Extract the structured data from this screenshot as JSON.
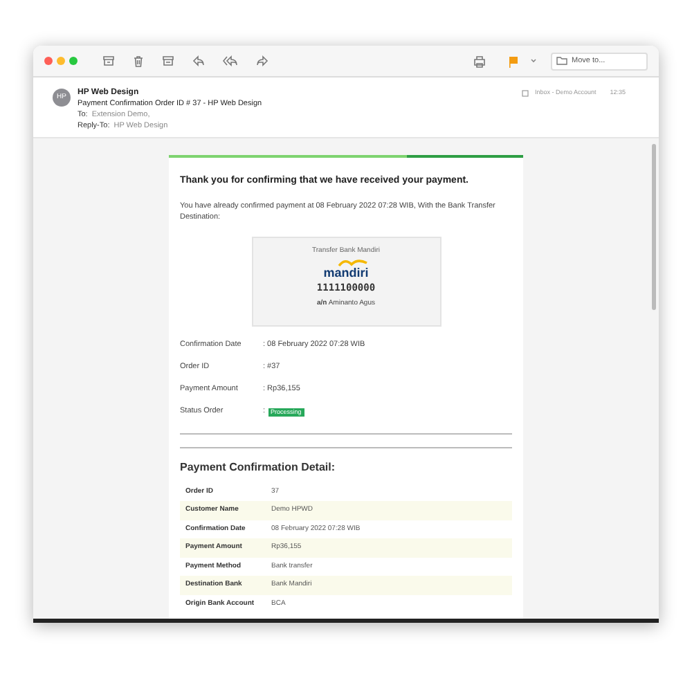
{
  "toolbar": {
    "move_to": "Move to..."
  },
  "header": {
    "avatar": "HP",
    "sender": "HP Web Design",
    "subject": "Payment Confirmation Order ID # 37 - HP Web Design",
    "to_label": "To:",
    "to": "Extension Demo,",
    "reply_label": "Reply-To:",
    "reply_to": "HP Web Design",
    "mailbox": "Inbox - Demo Account",
    "time": "12:35"
  },
  "email": {
    "heading": "Thank you for confirming that we have received your payment.",
    "intro": "You have already confirmed payment at 08 February 2022 07:28 WIB, With the Bank Transfer Destination:",
    "bank": {
      "title": "Transfer Bank Mandiri",
      "logo": "mandiri",
      "account": "1111100000",
      "holder": "**a/n** Aminanto Agus"
    },
    "summary": [
      {
        "label": "Confirmation Date",
        "value": ": 08 February 2022 07:28 WIB",
        "kind": "text"
      },
      {
        "label": "Order ID",
        "value": ": #37",
        "kind": "text"
      },
      {
        "label": "Payment Amount",
        "value": ": Rp36,155",
        "kind": "text"
      },
      {
        "label": "Status Order",
        "value": "Processing",
        "kind": "badge",
        "prefix": ":"
      }
    ],
    "detail_title": "Payment Confirmation Detail:",
    "detail_rows": [
      {
        "label": "Order ID",
        "value": "37"
      },
      {
        "label": "Customer Name",
        "value": "Demo HPWD"
      },
      {
        "label": "Confirmation Date",
        "value": "08 February 2022 07:28 WIB"
      },
      {
        "label": "Payment Amount",
        "value": "Rp36,155"
      },
      {
        "label": "Payment Method",
        "value": "Bank transfer"
      },
      {
        "label": "Destination Bank",
        "value": "Bank Mandiri"
      },
      {
        "label": "Origin Bank Account",
        "value": "BCA"
      }
    ]
  }
}
